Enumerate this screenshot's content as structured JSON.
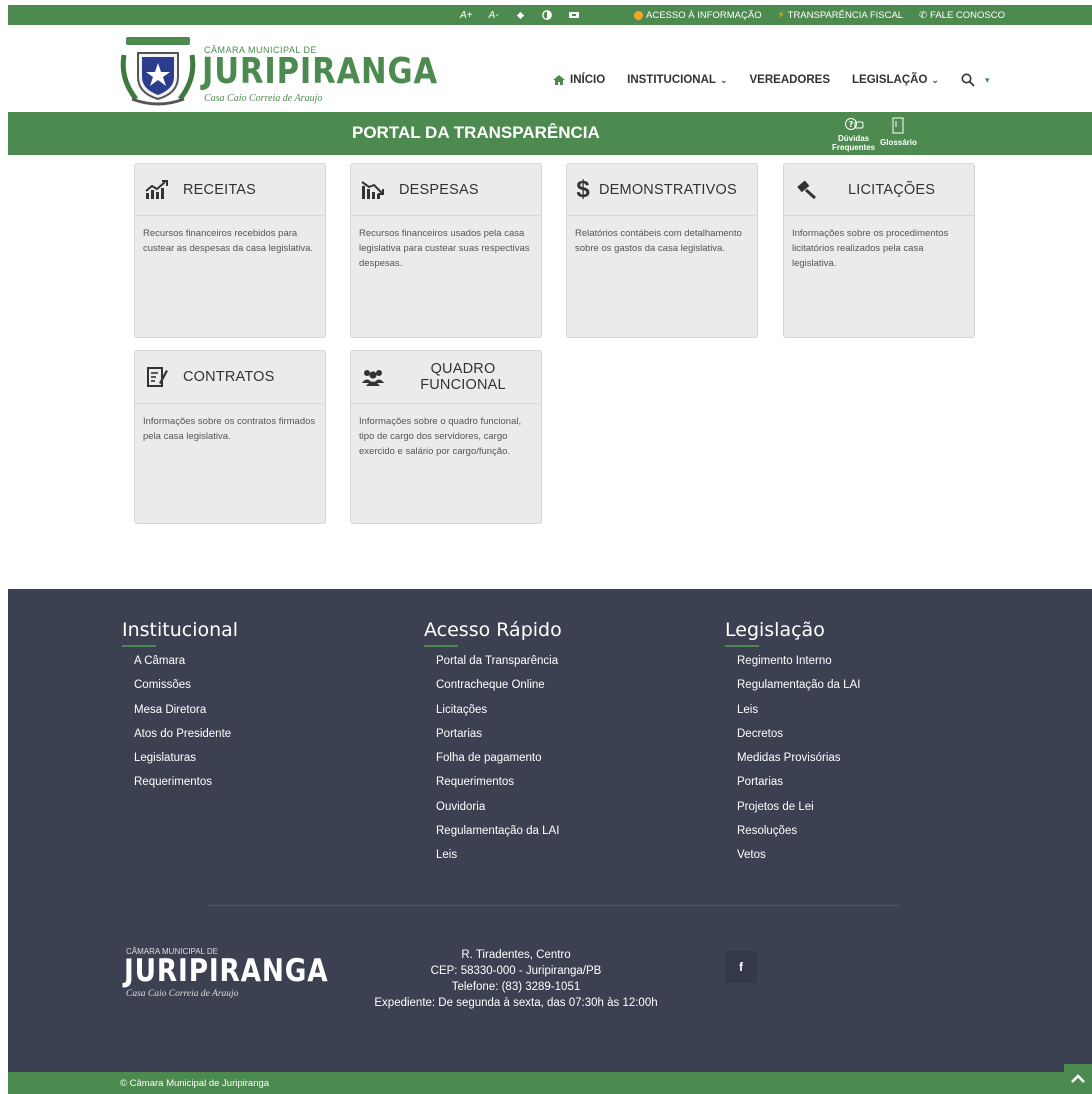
{
  "topbar": {
    "font_increase": "A+",
    "font_decrease": "A-",
    "acesso": "ACESSO À INFORMAÇÃO",
    "transparencia": "TRANSPARÊNCIA FISCAL",
    "fale": "FALE CONOSCO"
  },
  "logo": {
    "small": "CÂMARA MUNICIPAL DE",
    "name": "JURIPIRANGA",
    "tagline": "Casa Caio Correia de Araujo"
  },
  "nav": {
    "inicio": "INÍCIO",
    "institucional": "INSTITUCIONAL",
    "vereadores": "VEREADORES",
    "legislacao": "LEGISLAÇÃO"
  },
  "portal": {
    "title": "PORTAL DA TRANSPARÊNCIA",
    "duvidas_line1": "Dúvidas",
    "duvidas_line2": "Frequentes",
    "glossario": "Glossário"
  },
  "cards": [
    {
      "title": "RECEITAS",
      "desc": "Recursos financeiros recebidos para custear as despesas da casa legislativa."
    },
    {
      "title": "DESPESAS",
      "desc": "Recursos financeiros usados pela casa legislativa para custear suas respectivas despesas."
    },
    {
      "title": "DEMONSTRATIVOS",
      "desc": "Relatórios contábeis com detalhamento sobre os gastos da casa legislativa."
    },
    {
      "title": "LICITAÇÕES",
      "desc": "Informações sobre os procedimentos licitatórios realizados pela casa legislativa."
    },
    {
      "title": "CONTRATOS",
      "desc": "Informações sobre os contratos firmados pela casa legislativa."
    },
    {
      "title_line1": "QUADRO",
      "title_line2": "FUNCIONAL",
      "desc": "Informações sobre o quadro funcional, tipo de cargo dos servidores, cargo exercido e salário por cargo/função."
    }
  ],
  "footer": {
    "institucional": {
      "title": "Institucional",
      "items": [
        "A Câmara",
        "Comissões",
        "Mesa Diretora",
        "Atos do Presidente",
        "Legislaturas",
        "Requerimentos"
      ]
    },
    "acesso": {
      "title": "Acesso Rápido",
      "items": [
        "Portal da Transparência",
        "Contracheque Online",
        "Licitações",
        "Portarias",
        "Folha de pagamento",
        "Requerimentos",
        "Ouvidoria",
        "Regulamentação da LAI",
        "Leis"
      ]
    },
    "legislacao": {
      "title": "Legislação",
      "items": [
        "Regimento Interno",
        "Regulamentação da LAI",
        "Leis",
        "Decretos",
        "Medidas Provisórias",
        "Portarias",
        "Projetos de Lei",
        "Resoluções",
        "Vetos"
      ]
    },
    "address": {
      "line1": "R. Tiradentes, Centro",
      "line2": "CEP: 58330-000 - Juripiranga/PB",
      "line3": "Telefone: (83) 3289-1051",
      "line4": "Expediente: De segunda à sexta, das 07:30h às 12:00h"
    },
    "facebook": "f",
    "copyright": "© Câmara Municipal de Juripiranga"
  },
  "icons": {
    "home": "home-icon",
    "search": "search-icon",
    "scroll_top": "chevron-up-icon"
  },
  "colors": {
    "brand_green": "#4d8a4f",
    "footer_bg": "#3c4152",
    "card_bg": "#ebebeb"
  }
}
